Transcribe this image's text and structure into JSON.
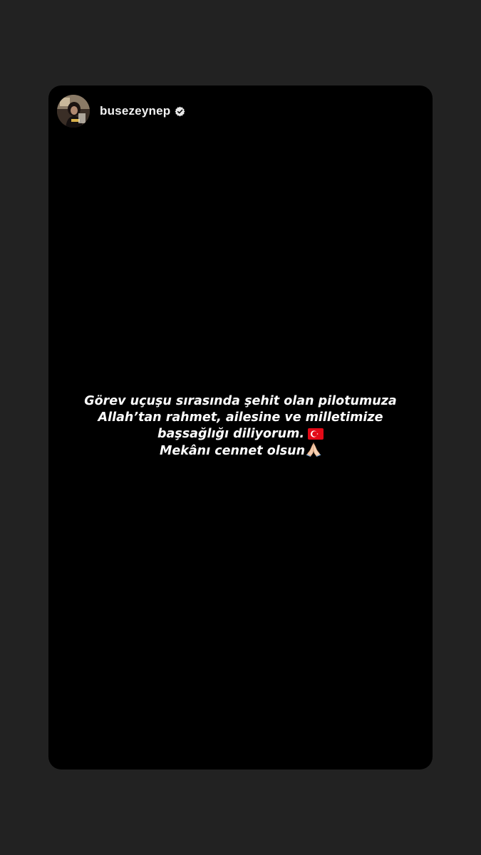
{
  "story": {
    "username": "busezeynep",
    "verified": true,
    "avatar_icon": "profile-photo",
    "badge_icon": "verified-badge-icon",
    "lines": [
      "Görev uçuşu sırasında şehit olan pilotumuza",
      "Allah’tan rahmet, ailesine ve milletimize",
      "başsağlığı diliyorum.",
      "Mekânı cennet olsun"
    ],
    "emojis": {
      "line3": "turkish-flag-icon",
      "line4": "praying-hands-icon"
    }
  },
  "colors": {
    "page_background": "#222222",
    "card_background": "#000000",
    "text": "#ffffff",
    "flag_red": "#e30a17"
  }
}
